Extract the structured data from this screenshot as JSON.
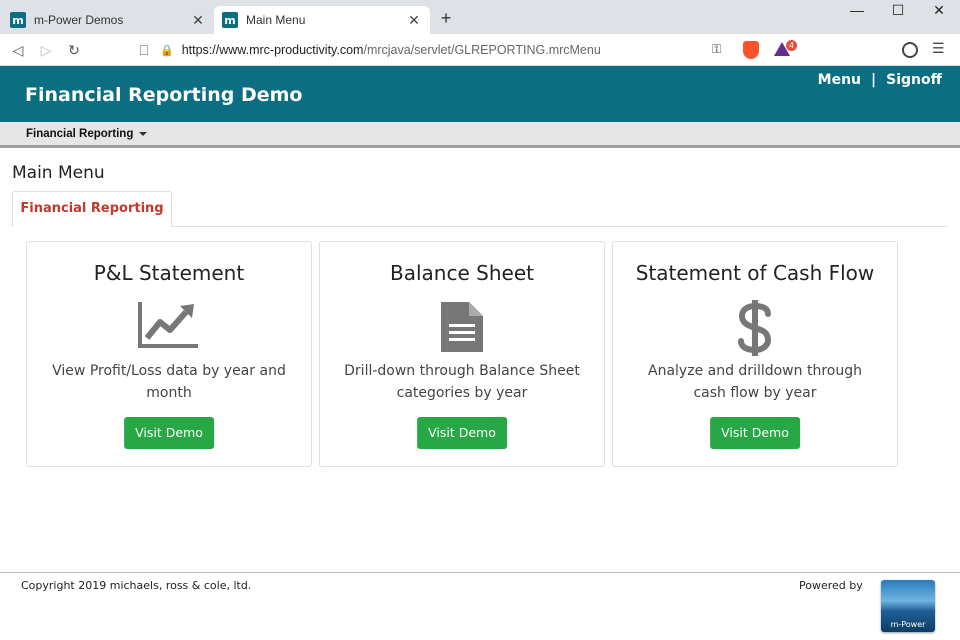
{
  "browser": {
    "tabs": [
      {
        "title": "m-Power Demos",
        "favicon": "m"
      },
      {
        "title": "Main Menu",
        "favicon": "m"
      }
    ],
    "new_tab": "+",
    "window_controls": {
      "minimize": "—",
      "maximize": "☐",
      "close": "✕"
    },
    "url_host": "https://www.mrc-productivity.com",
    "url_path": "/mrcjava/servlet/GLREPORTING.mrcMenu",
    "bat_badge": "4"
  },
  "header": {
    "title": "Financial Reporting Demo",
    "menu_link": "Menu",
    "separator": "|",
    "signoff_link": "Signoff"
  },
  "subnav": {
    "item": "Financial Reporting"
  },
  "page": {
    "title": "Main Menu",
    "tab": "Financial Reporting"
  },
  "cards": [
    {
      "title": "P&L Statement",
      "icon": "line-chart-icon",
      "description": "View Profit/Loss data by year and month",
      "button": "Visit Demo"
    },
    {
      "title": "Balance Sheet",
      "icon": "document-icon",
      "description": "Drill-down through Balance Sheet categories by year",
      "button": "Visit Demo"
    },
    {
      "title": "Statement of Cash Flow",
      "icon": "dollar-icon",
      "description": "Analyze and drilldown through cash flow by year",
      "button": "Visit Demo"
    }
  ],
  "footer": {
    "copyright": "Copyright 2019 michaels, ross & cole, ltd.",
    "powered_by": "Powered by",
    "logo_text": "m-Power"
  },
  "colors": {
    "header_bg": "#0b6e82",
    "button_green": "#28a745",
    "tab_text": "#c0392b",
    "icon_gray": "#777777"
  }
}
